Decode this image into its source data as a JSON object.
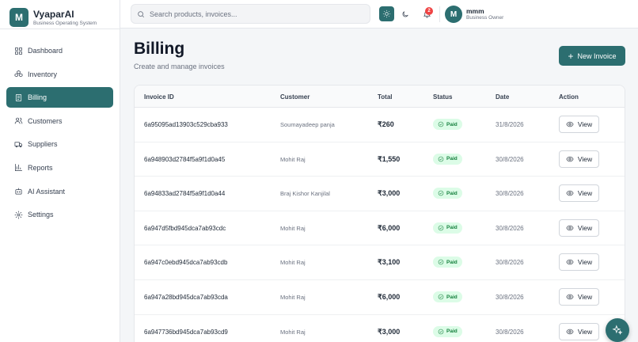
{
  "brand": {
    "logo_letter": "M",
    "name": "VyaparAI",
    "tagline": "Business Operating System"
  },
  "nav": [
    {
      "label": "Dashboard",
      "icon": "grid-icon",
      "active": false
    },
    {
      "label": "Inventory",
      "icon": "boxes-icon",
      "active": false
    },
    {
      "label": "Billing",
      "icon": "receipt-icon",
      "active": true
    },
    {
      "label": "Customers",
      "icon": "users-icon",
      "active": false
    },
    {
      "label": "Suppliers",
      "icon": "truck-icon",
      "active": false
    },
    {
      "label": "Reports",
      "icon": "bar-chart-icon",
      "active": false
    },
    {
      "label": "AI Assistant",
      "icon": "bot-icon",
      "active": false
    },
    {
      "label": "Settings",
      "icon": "gear-icon",
      "active": false
    }
  ],
  "topbar": {
    "search_placeholder": "Search products, invoices...",
    "notification_count": "2",
    "user": {
      "initial": "M",
      "name": "mmm",
      "role": "Business Owner"
    }
  },
  "page": {
    "title": "Billing",
    "subtitle": "Create and manage invoices",
    "new_invoice_label": "New Invoice"
  },
  "table": {
    "columns": [
      "Invoice ID",
      "Customer",
      "Total",
      "Status",
      "Date",
      "Action"
    ],
    "view_label": "View",
    "rows": [
      {
        "id": "6a95095ad13903c529cba933",
        "customer": "Soumayadeep panja",
        "total": "₹260",
        "status": "Paid",
        "date": "31/8/2026"
      },
      {
        "id": "6a948903d2784f5a9f1d0a45",
        "customer": "Mohit Raj",
        "total": "₹1,550",
        "status": "Paid",
        "date": "30/8/2026"
      },
      {
        "id": "6a94833ad2784f5a9f1d0a44",
        "customer": "Braj Kishor Kanjilal",
        "total": "₹3,000",
        "status": "Paid",
        "date": "30/8/2026"
      },
      {
        "id": "6a947d5fbd945dca7ab93cdc",
        "customer": "Mohit Raj",
        "total": "₹6,000",
        "status": "Paid",
        "date": "30/8/2026"
      },
      {
        "id": "6a947c0ebd945dca7ab93cdb",
        "customer": "Mohit Raj",
        "total": "₹3,100",
        "status": "Paid",
        "date": "30/8/2026"
      },
      {
        "id": "6a947a28bd945dca7ab93cda",
        "customer": "Mohit Raj",
        "total": "₹6,000",
        "status": "Paid",
        "date": "30/8/2026"
      },
      {
        "id": "6a947736bd945dca7ab93cd9",
        "customer": "Mohit Raj",
        "total": "₹3,000",
        "status": "Paid",
        "date": "30/8/2026"
      }
    ]
  },
  "colors": {
    "accent": "#2c6e70",
    "paid_bg": "#dcfce7",
    "paid_text": "#15803d",
    "badge": "#ef4444"
  }
}
